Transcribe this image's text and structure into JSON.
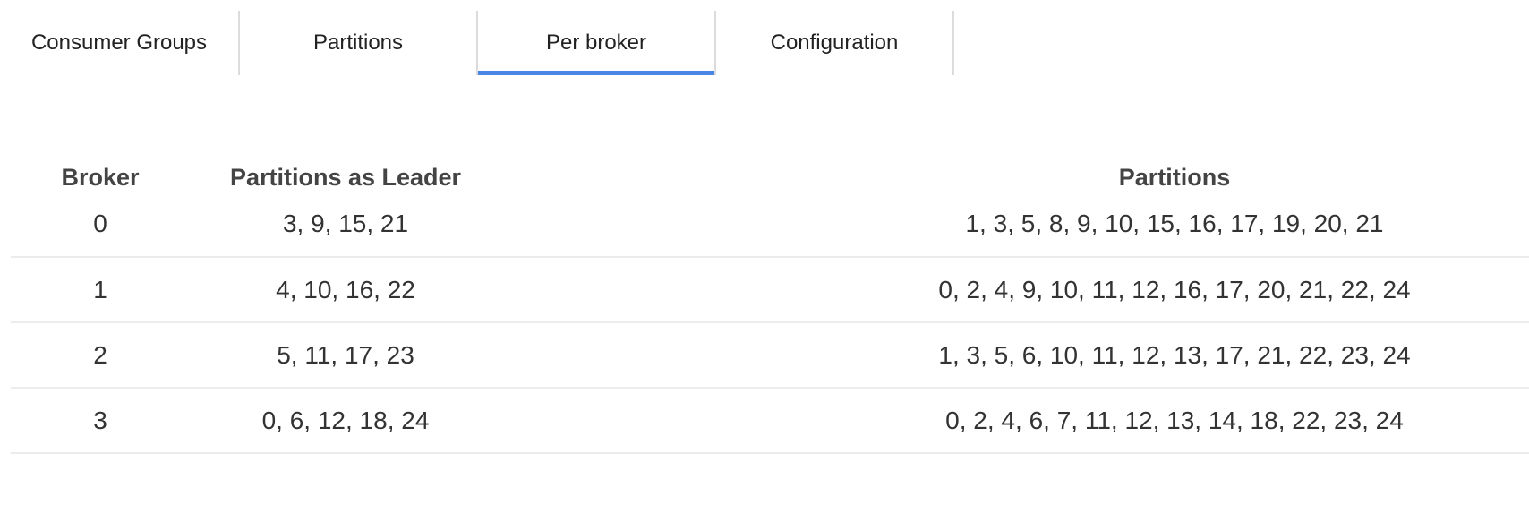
{
  "tabs": [
    {
      "label": "Consumer Groups",
      "active": false
    },
    {
      "label": "Partitions",
      "active": false
    },
    {
      "label": "Per broker",
      "active": true
    },
    {
      "label": "Configuration",
      "active": false
    }
  ],
  "accent_color": "#4a86e8",
  "table": {
    "headers": [
      "Broker",
      "Partitions as Leader",
      "Partitions"
    ],
    "rows": [
      {
        "broker": "0",
        "leader": "3, 9, 15, 21",
        "partitions": "1, 3, 5, 8, 9, 10, 15, 16, 17, 19, 20, 21"
      },
      {
        "broker": "1",
        "leader": "4, 10, 16, 22",
        "partitions": "0, 2, 4, 9, 10, 11, 12, 16, 17, 20, 21, 22, 24"
      },
      {
        "broker": "2",
        "leader": "5, 11, 17, 23",
        "partitions": "1, 3, 5, 6, 10, 11, 12, 13, 17, 21, 22, 23, 24"
      },
      {
        "broker": "3",
        "leader": "0, 6, 12, 18, 24",
        "partitions": "0, 2, 4, 6, 7, 11, 12, 13, 14, 18, 22, 23, 24"
      }
    ]
  }
}
